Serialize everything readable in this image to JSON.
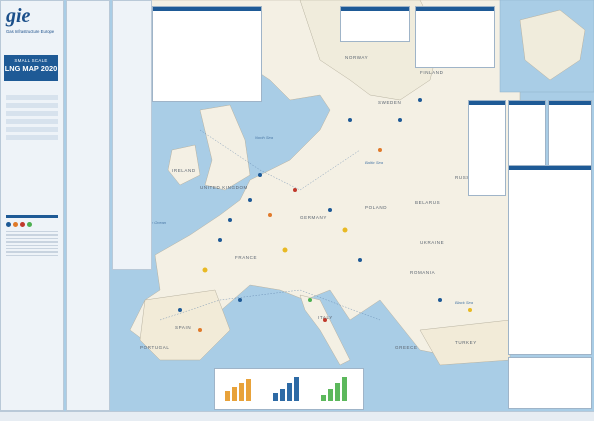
{
  "brand": {
    "logo": "gie",
    "org": "Gas Infrastructure Europe"
  },
  "title": {
    "line1": "SMALL SCALE",
    "line2": "LNG MAP 2020"
  },
  "map_labels": {
    "norway": "NORWAY",
    "sweden": "SWEDEN",
    "finland": "FINLAND",
    "russia": "RUSSIA",
    "belarus": "BELARUS",
    "ukraine": "UKRAINE",
    "poland": "POLAND",
    "germany": "GERMANY",
    "france": "FRANCE",
    "spain": "SPAIN",
    "italy": "ITALY",
    "romania": "ROMANIA",
    "turkey": "TURKEY",
    "greece": "GREECE",
    "ireland": "IRELAND",
    "uk": "UNITED KINGDOM",
    "portugal": "PORTUGAL"
  },
  "seas": {
    "north_sea": "North Sea",
    "atlantic": "Atlantic Ocean",
    "baltic": "Baltic Sea",
    "black_sea": "Black Sea",
    "med": "Mediterranean Sea"
  },
  "colors": {
    "sea": "#a9cde6",
    "land": "#f4f0e4",
    "panel_header": "#1e5a96",
    "accent_orange": "#e07a2a",
    "accent_red": "#c0392b",
    "accent_green": "#4caf50",
    "accent_yellow": "#e8b923"
  },
  "icons": [
    "lng-terminal-icon",
    "bunkering-vessel-icon",
    "truck-loading-icon",
    "ship-icon"
  ]
}
